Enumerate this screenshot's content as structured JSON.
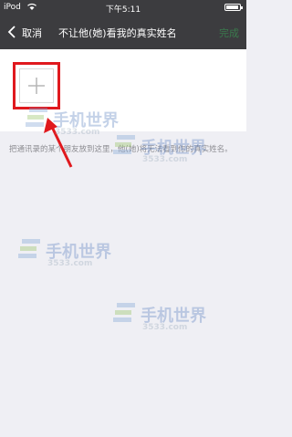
{
  "status_bar": {
    "carrier": "iPod",
    "time": "下午5:11"
  },
  "nav": {
    "cancel_label": "取消",
    "title": "不让他(她)看我的真实姓名",
    "done_label": "完成"
  },
  "hint_text": "把通讯录的某个朋友放到这里，他(她)将无法看到你的真实姓名。",
  "watermark": {
    "text": "手机世界",
    "domain": "3533.com"
  },
  "colors": {
    "nav_bg": "#3c3c3f",
    "highlight": "#e0191e",
    "done_disabled": "#3a7a4d",
    "background": "#efeff4"
  }
}
